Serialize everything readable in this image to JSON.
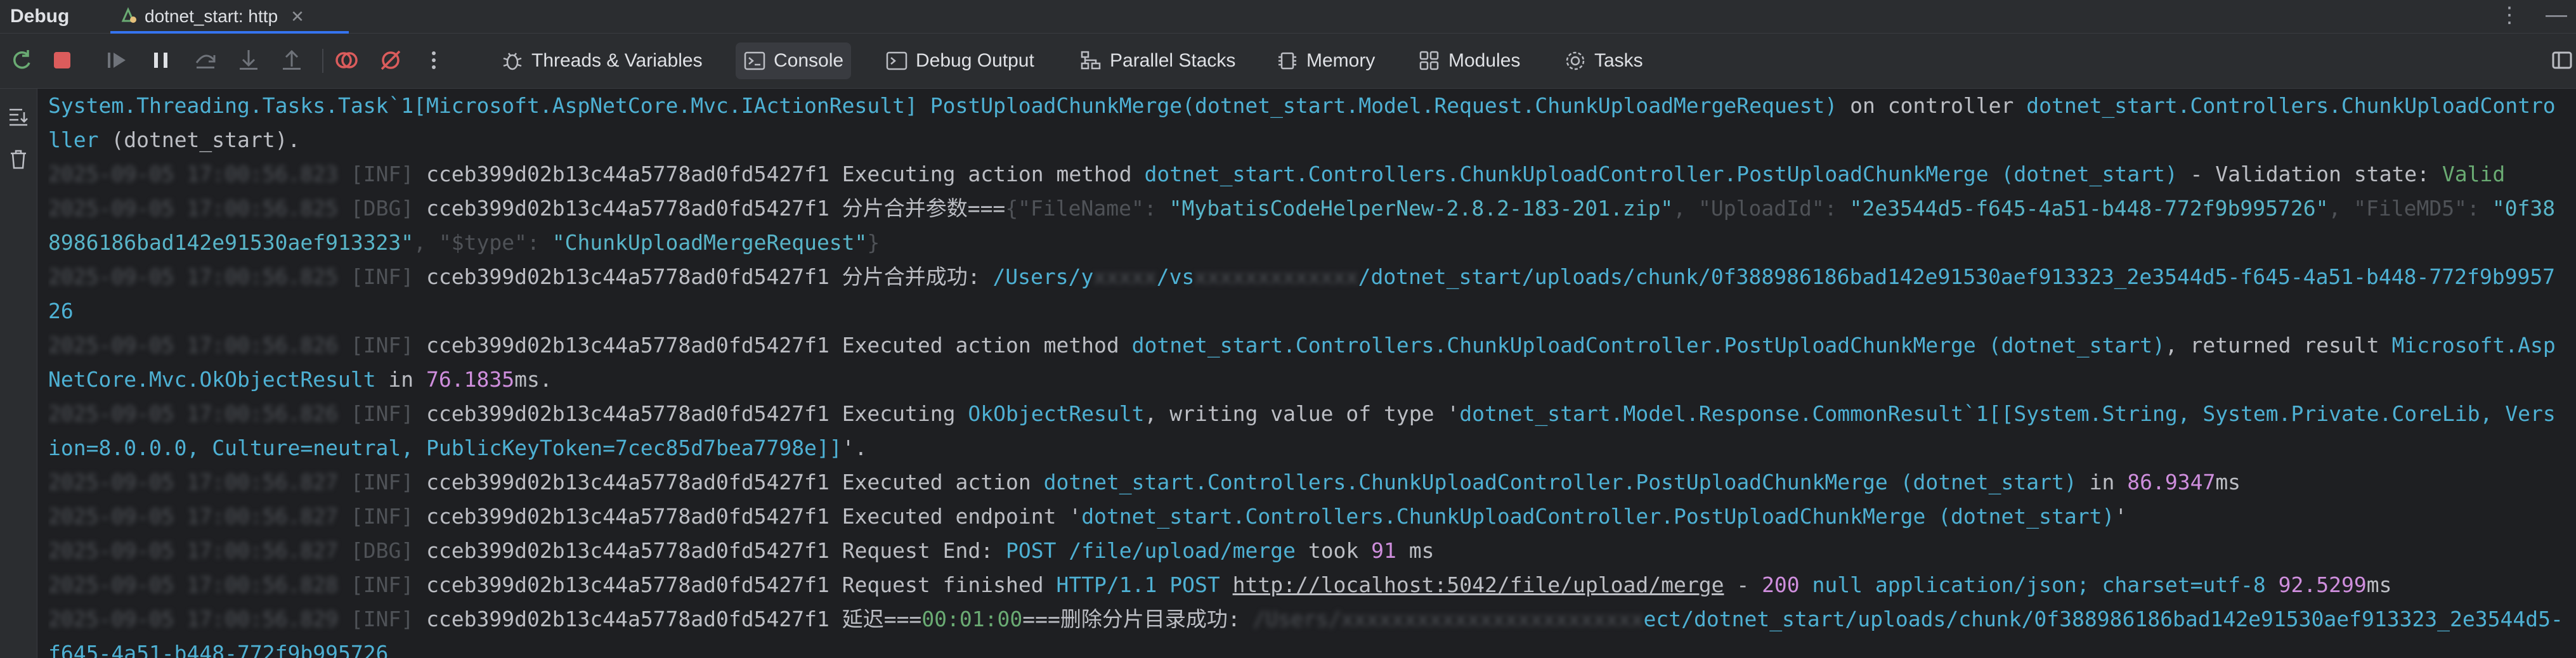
{
  "titlebar": {
    "title": "Debug",
    "tab_label": "dotnet_start: http"
  },
  "toolbar": {
    "tabs": [
      "Threads & Variables",
      "Console",
      "Debug Output",
      "Parallel Stacks",
      "Memory",
      "Modules",
      "Tasks"
    ]
  },
  "log": {
    "l0a": "System.Threading.Tasks.Task`1[Microsoft.AspNetCore.Mvc.IActionResult] PostUploadChunkMerge(dotnet_start.Model.Request.ChunkUploadMergeRequest)",
    "l0b": " on controller ",
    "l0c": "dotnet_start.Controllers.ChunkUploadController",
    "l0d": " (dotnet_start).",
    "l1_ts": "2025-09-05 17:00:56.823",
    "l1_lvl": "[INF]",
    "l1_id": "cceb399d02b13c44a5778ad0fd5427f1",
    "l1_a": " Executing action method ",
    "l1_b": "dotnet_start.Controllers.ChunkUploadController.PostUploadChunkMerge (dotnet_start)",
    "l1_c": " - Validation state: ",
    "l1_d": "Valid",
    "l2_ts": "2025-09-05 17:00:56.825",
    "l2_lvl": "[DBG]",
    "l2_id": "cceb399d02b13c44a5778ad0fd5427f1",
    "l2_a": " 分片合并参数===",
    "l2_b": "{\"FileName\": ",
    "l2_c": "\"MybatisCodeHelperNew-2.8.2-183-201.zip\"",
    "l2_d": ", \"UploadId\": ",
    "l2_e": "\"2e3544d5-f645-4a51-b448-772f9b995726\"",
    "l2_f": ", \"FileMD5\": ",
    "l2_g": "\"0f388986186bad142e91530aef913323\"",
    "l2_h": ", \"$type\": ",
    "l2_i": "\"ChunkUploadMergeRequest\"",
    "l2_j": "}",
    "l3_ts": "2025-09-05 17:00:56.825",
    "l3_lvl": "[INF]",
    "l3_id": "cceb399d02b13c44a5778ad0fd5427f1",
    "l3_a": " 分片合并成功: ",
    "l3_b": "/Users/y",
    "l3_c": "xxxxx",
    "l3_d": "/vs",
    "l3_e": "xxxxxxxxxxxxx",
    "l3_f": "/dotnet_start/uploads/chunk/0f388986186bad142e91530aef913323_2e3544d5-f645-4a51-b448-772f9b995726",
    "l4_ts": "2025-09-05 17:00:56.826",
    "l4_lvl": "[INF]",
    "l4_id": "cceb399d02b13c44a5778ad0fd5427f1",
    "l4_a": " Executed action method ",
    "l4_b": "dotnet_start.Controllers.ChunkUploadController.PostUploadChunkMerge (dotnet_start)",
    "l4_c": ", returned result ",
    "l4_d": "Microsoft.AspNetCore.Mvc.OkObjectResult",
    "l4_e": " in ",
    "l4_f": "76.1835",
    "l4_g": "ms.",
    "l5_ts": "2025-09-05 17:00:56.826",
    "l5_lvl": "[INF]",
    "l5_id": "cceb399d02b13c44a5778ad0fd5427f1",
    "l5_a": " Executing ",
    "l5_b": "OkObjectResult",
    "l5_c": ", writing value of type '",
    "l5_d": "dotnet_start.Model.Response.CommonResult`1[[System.String, System.Private.CoreLib, Version=8.0.0.0, Culture=neutral, PublicKeyToken=7cec85d7bea7798e]]",
    "l5_e": "'.",
    "l6_ts": "2025-09-05 17:00:56.827",
    "l6_lvl": "[INF]",
    "l6_id": "cceb399d02b13c44a5778ad0fd5427f1",
    "l6_a": " Executed action ",
    "l6_b": "dotnet_start.Controllers.ChunkUploadController.PostUploadChunkMerge (dotnet_start)",
    "l6_c": " in ",
    "l6_d": "86.9347",
    "l6_e": "ms",
    "l7_ts": "2025-09-05 17:00:56.827",
    "l7_lvl": "[INF]",
    "l7_id": "cceb399d02b13c44a5778ad0fd5427f1",
    "l7_a": " Executed endpoint '",
    "l7_b": "dotnet_start.Controllers.ChunkUploadController.PostUploadChunkMerge (dotnet_start)",
    "l7_c": "'",
    "l8_ts": "2025-09-05 17:00:56.827",
    "l8_lvl": "[DBG]",
    "l8_id": "cceb399d02b13c44a5778ad0fd5427f1",
    "l8_a": " Request End: ",
    "l8_b": "POST /file/upload/merge",
    "l8_c": " took ",
    "l8_d": "91",
    "l8_e": " ms",
    "l9_ts": "2025-09-05 17:00:56.828",
    "l9_lvl": "[INF]",
    "l9_id": "cceb399d02b13c44a5778ad0fd5427f1",
    "l9_a": " Request finished ",
    "l9_b": "HTTP/1.1 POST ",
    "l9_c": "http://localhost:5042/file/upload/merge",
    "l9_d": " - ",
    "l9_e": "200",
    "l9_f": " ",
    "l9_g": "null",
    "l9_h": " application/json; charset=utf-8 ",
    "l9_i": "92.5299",
    "l9_j": "ms",
    "l10_ts": "2025-09-05 17:00:56.829",
    "l10_lvl": "[INF]",
    "l10_id": "cceb399d02b13c44a5778ad0fd5427f1",
    "l10_a": " 延迟===",
    "l10_b": "00:01:00",
    "l10_c": "===删除分片目录成功: ",
    "l10_d": "/Users/xxxxxxxxxxxxxxxxxxxxxxxx",
    "l10_e": "ect/dotnet_start/uploads/chunk/0f388986186bad142e91530aef913323_2e3544d5-f645-4a51-b448-772f9b995726"
  }
}
